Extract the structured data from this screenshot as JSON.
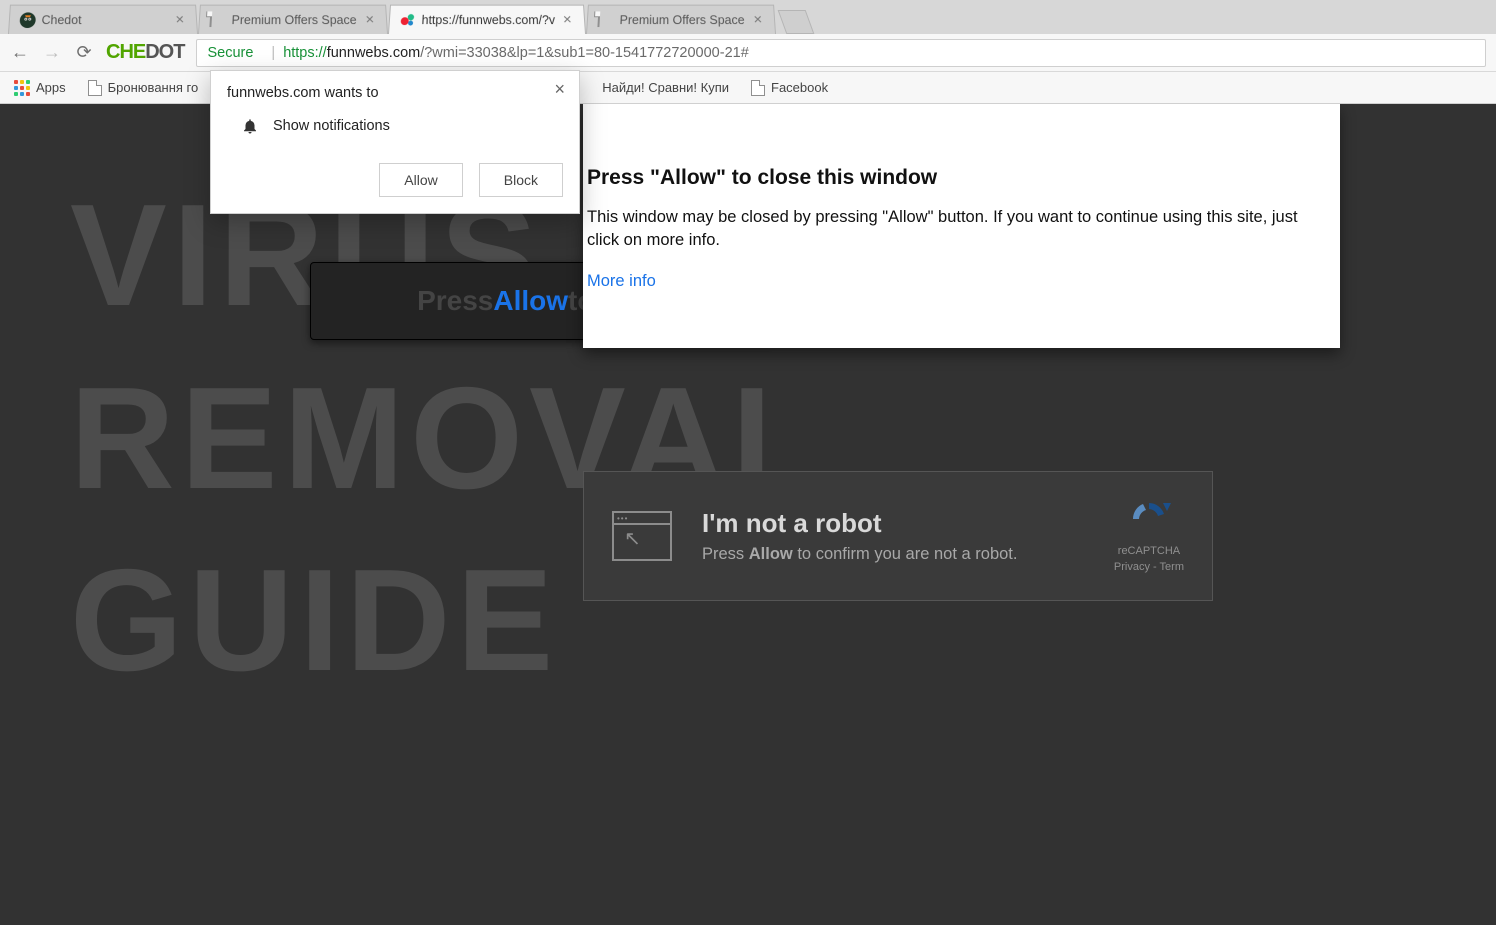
{
  "tabs": [
    {
      "title": "Chedot"
    },
    {
      "title": "Premium Offers Space"
    },
    {
      "title": "https://funnwebs.com/?v"
    },
    {
      "title": "Premium Offers Space"
    }
  ],
  "active_tab_index": 2,
  "address_bar": {
    "secure_label": "Secure",
    "scheme": "https://",
    "host": "funnwebs.com",
    "path": "/?wmi=33038&lp=1&sub1=80-1541772720000-21#"
  },
  "bookmarks": {
    "apps_label": "Apps",
    "items": [
      "Бронювання го",
      "Найди! Сравни! Купи",
      "Facebook"
    ]
  },
  "permission_dialog": {
    "origin_line": "funnwebs.com wants to",
    "request_line": "Show notifications",
    "allow_label": "Allow",
    "block_label": "Block"
  },
  "watermark_lines": [
    "VIRUS",
    "REMOVAL",
    "GUIDE"
  ],
  "dark_banner": {
    "prefix": "Press ",
    "allow_word": "Allow",
    "suffix": " to proc"
  },
  "white_popup": {
    "heading": "Press \"Allow\" to close this window",
    "body": "This window may be closed by pressing \"Allow\" button. If you want to continue using this site, just click on more info.",
    "more_info": "More info"
  },
  "captcha": {
    "title": "I'm not a robot",
    "line_prefix": "Press ",
    "line_bold": "Allow",
    "line_suffix": " to confirm you are not a robot.",
    "brand": "reCAPTCHA",
    "privacy": "Privacy",
    "terms": "Term"
  }
}
